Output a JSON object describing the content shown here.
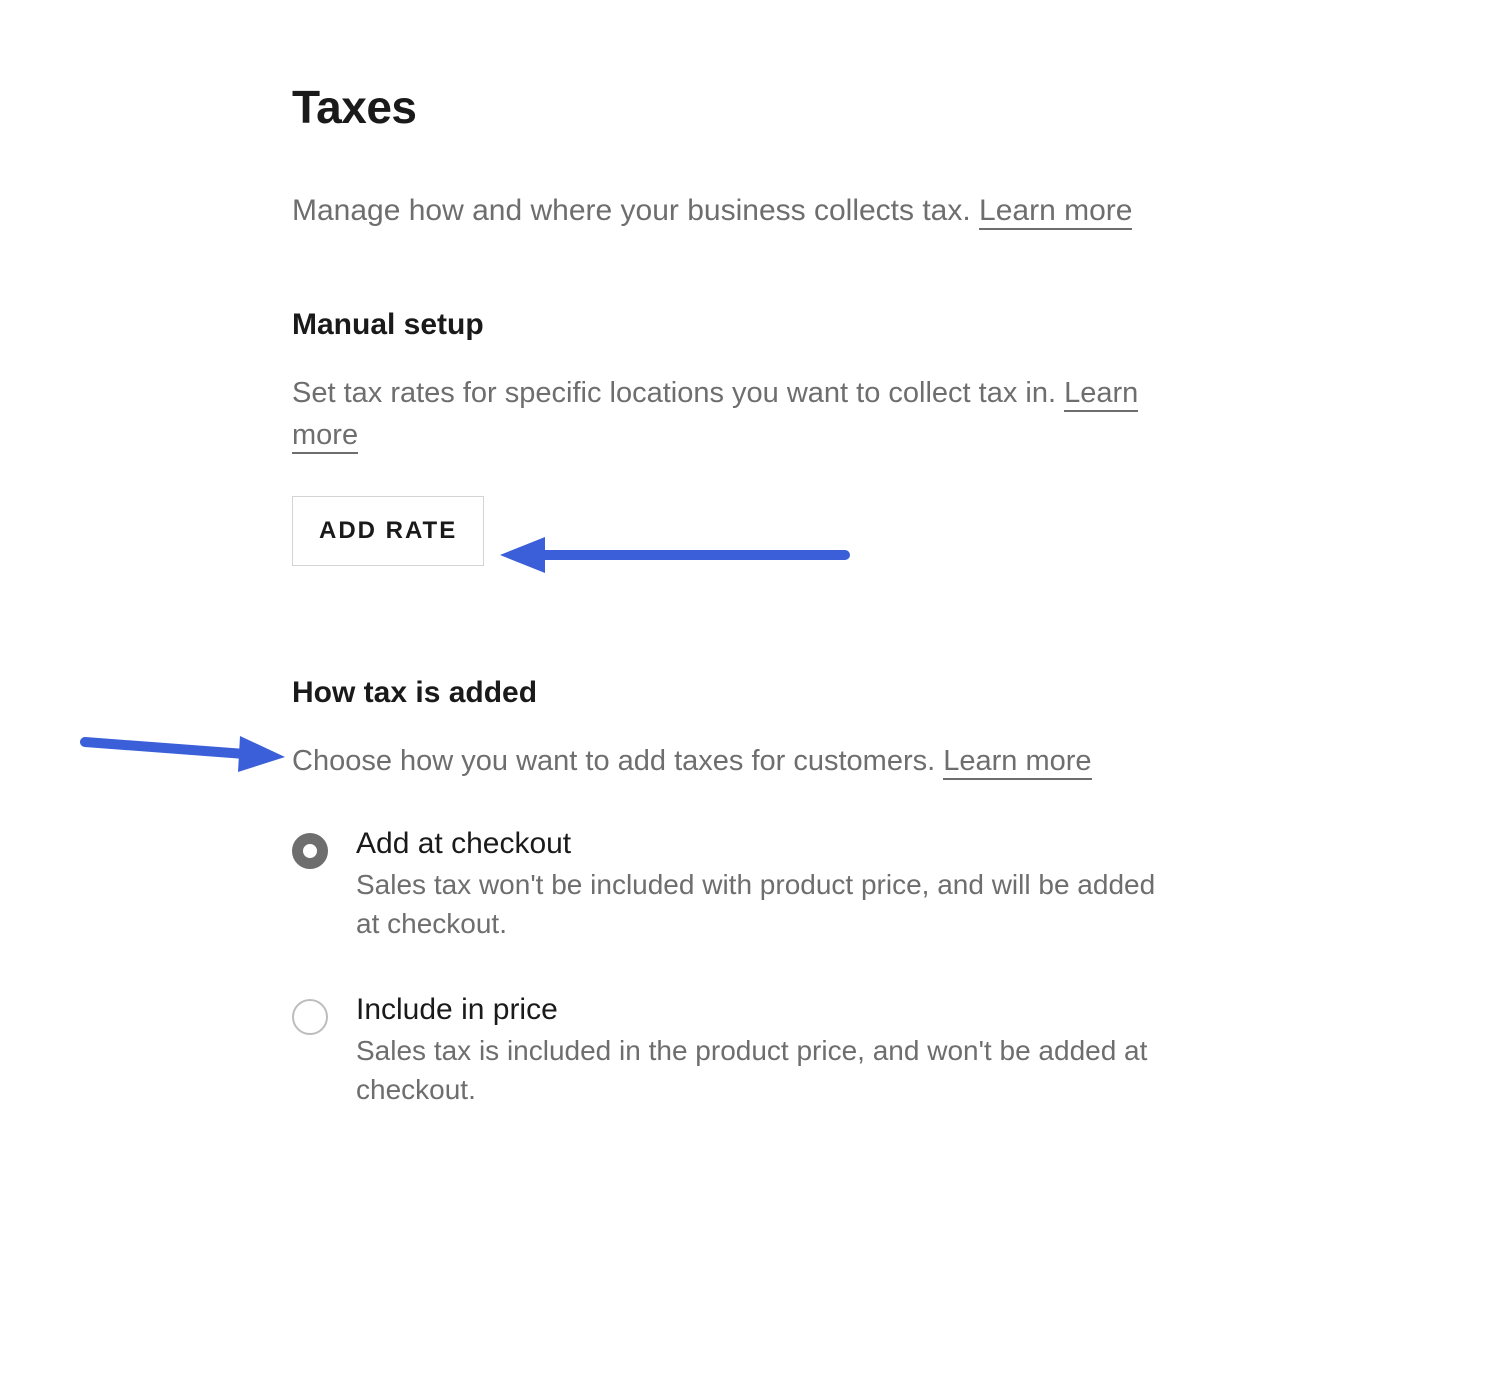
{
  "page": {
    "title": "Taxes",
    "description": "Manage how and where your business collects tax. ",
    "learn_more": "Learn more"
  },
  "manual_setup": {
    "heading": "Manual setup",
    "description": "Set tax rates for specific locations you want to collect tax in. ",
    "learn_more": "Learn more",
    "add_rate_label": "ADD RATE"
  },
  "how_tax": {
    "heading": "How tax is added",
    "description": "Choose how you want to add taxes for customers. ",
    "learn_more": "Learn more",
    "options": [
      {
        "label": "Add at checkout",
        "description": "Sales tax won't be included with product price, and will be added at checkout.",
        "selected": true
      },
      {
        "label": "Include in price",
        "description": "Sales tax is included in the product price, and won't be added at checkout.",
        "selected": false
      }
    ]
  },
  "annotations": {
    "arrow_color": "#3a5fd9"
  }
}
